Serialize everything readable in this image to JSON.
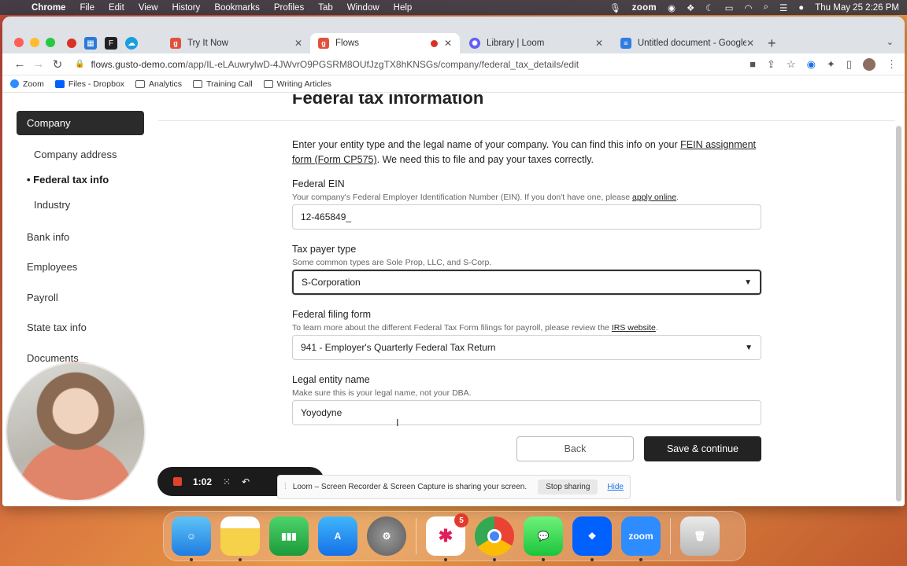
{
  "menubar": {
    "app": "Chrome",
    "items": [
      "File",
      "Edit",
      "View",
      "History",
      "Bookmarks",
      "Profiles",
      "Tab",
      "Window",
      "Help"
    ],
    "zoom": "zoom",
    "clock": "Thu May 25  2:26 PM"
  },
  "browser": {
    "tabs": [
      {
        "title": "Try It Now",
        "fav_color": "#e0513d"
      },
      {
        "title": "Flows",
        "fav_color": "#e0513d"
      },
      {
        "title": "Library | Loom",
        "fav_color": "#625df5"
      },
      {
        "title": "Untitled document - Google Do",
        "fav_color": "#2f7de1"
      }
    ],
    "url": {
      "host": "flows.gusto-demo.com",
      "path": "/app/IL-eLAuwrylwD-4JWvrO9PGSRM8OUfJzgTX8hKNSGs/company/federal_tax_details/edit"
    },
    "bookmarks": [
      "Zoom",
      "Files - Dropbox",
      "Analytics",
      "Training Call",
      "Writing Articles"
    ]
  },
  "page": {
    "section_title": "Federal tax information",
    "sidebar": {
      "active": "Company",
      "subitems": [
        "Company address",
        "• Federal tax info",
        "Industry"
      ],
      "items": [
        "Bank info",
        "Employees",
        "Payroll",
        "State tax info",
        "Documents"
      ]
    },
    "intro": {
      "text1": "Enter your entity type and the legal name of your company. You can find this info on your ",
      "link1": "FEIN assignment form (Form CP575)",
      "text2": ". We need this to file and pay your taxes correctly."
    },
    "fields": {
      "ein": {
        "label": "Federal EIN",
        "help": "Your company's Federal Employer Identification Number (EIN). If you don't have one, please ",
        "help_link": "apply online",
        "help_end": ".",
        "value": "12-465849_"
      },
      "payer": {
        "label": "Tax payer type",
        "help": "Some common types are Sole Prop, LLC, and S-Corp.",
        "value": "S-Corporation"
      },
      "filing": {
        "label": "Federal filing form",
        "help": "To learn more about the different Federal Tax Form filings for payroll, please review the ",
        "help_link": "IRS website",
        "help_end": ".",
        "value": "941 - Employer's Quarterly Federal Tax Return"
      },
      "legal": {
        "label": "Legal entity name",
        "help": "Make sure this is your legal name, not your DBA.",
        "value": "Yoyodyne"
      }
    },
    "buttons": {
      "back": "Back",
      "save": "Save & continue"
    }
  },
  "loom": {
    "timer": "1:02",
    "share_text": "Loom – Screen Recorder & Screen Capture is sharing your screen.",
    "stop": "Stop sharing",
    "hide": "Hide"
  },
  "dock": {
    "slack_badge": "5",
    "zoom_label": "zoom"
  }
}
